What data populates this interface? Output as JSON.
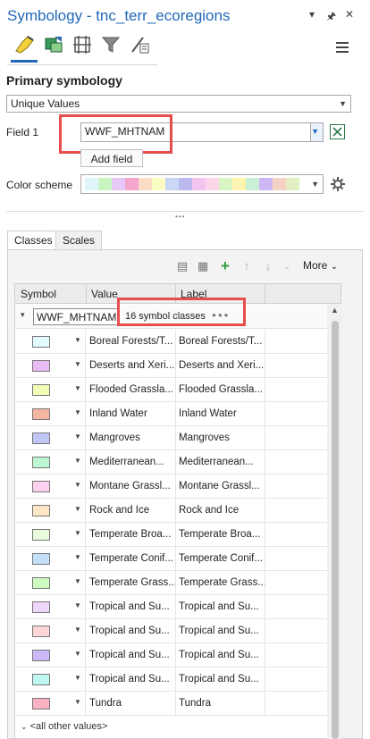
{
  "window": {
    "title": "Symbology - tnc_terr_ecoregions",
    "controls": [
      "▾",
      "🖈",
      "✕"
    ]
  },
  "ribbon": {
    "icons": [
      "primary-symbology-icon",
      "vary-symbology-icon",
      "label-classes-icon",
      "filter-icon",
      "illumination-icon"
    ]
  },
  "section_title": "Primary symbology",
  "symbology_method": "Unique Values",
  "field1": {
    "label": "Field 1",
    "value": "WWF_MHTNAM",
    "add_field_label": "Add field"
  },
  "color_scheme": {
    "label": "Color scheme",
    "colors": [
      "#dff5fb",
      "#c9f5c2",
      "#e6c8f7",
      "#f4a6cc",
      "#fbdcc4",
      "#fbfbc4",
      "#c9d6f5",
      "#bdb8f0",
      "#f3c4ee",
      "#fbd6ea",
      "#d9f5c2",
      "#fff3b0",
      "#c8f0d4",
      "#cdb8f5",
      "#f5d2c4",
      "#e0f0c4"
    ]
  },
  "tabs": [
    {
      "label": "Classes"
    },
    {
      "label": "Scales"
    }
  ],
  "toolbar": {
    "more_label": "More"
  },
  "table": {
    "headers": {
      "symbol": "Symbol",
      "value": "Value",
      "label": "Label"
    },
    "group": {
      "field": "WWF_MHTNAM",
      "count_label": "16 symbol classes",
      "menu": "●●●"
    },
    "rows": [
      {
        "color": "#e3fbfd",
        "value": "Boreal Forests/T...",
        "label": "Boreal Forests/T..."
      },
      {
        "color": "#eabcf6",
        "value": "Deserts and Xeri...",
        "label": "Deserts and Xeri..."
      },
      {
        "color": "#f2fdb8",
        "value": "Flooded Grassla...",
        "label": "Flooded Grassla..."
      },
      {
        "color": "#f6b6a4",
        "value": "Inland Water",
        "label": "Inland Water"
      },
      {
        "color": "#bfc6f6",
        "value": "Mangroves",
        "label": "Mangroves"
      },
      {
        "color": "#bdf6d2",
        "value": "Mediterranean...",
        "label": "Mediterranean..."
      },
      {
        "color": "#fcd0ee",
        "value": "Montane Grassl...",
        "label": "Montane Grassl..."
      },
      {
        "color": "#fce6c4",
        "value": "Rock and Ice",
        "label": "Rock and Ice"
      },
      {
        "color": "#e8fbdc",
        "value": "Temperate Broa...",
        "label": "Temperate Broa..."
      },
      {
        "color": "#c4e0f8",
        "value": "Temperate Conif...",
        "label": "Temperate Conif..."
      },
      {
        "color": "#ccfac0",
        "value": "Temperate Grass...",
        "label": "Temperate Grass..."
      },
      {
        "color": "#eed6fb",
        "value": "Tropical and Su...",
        "label": "Tropical and Su..."
      },
      {
        "color": "#fcd6d6",
        "value": "Tropical and Su...",
        "label": "Tropical and Su..."
      },
      {
        "color": "#cbb8f6",
        "value": "Tropical and Su...",
        "label": "Tropical and Su..."
      },
      {
        "color": "#bef8f0",
        "value": "Tropical and Su...",
        "label": "Tropical and Su..."
      },
      {
        "color": "#f8b2c4",
        "value": "Tundra",
        "label": "Tundra"
      }
    ],
    "other_values": "<all other values>"
  }
}
